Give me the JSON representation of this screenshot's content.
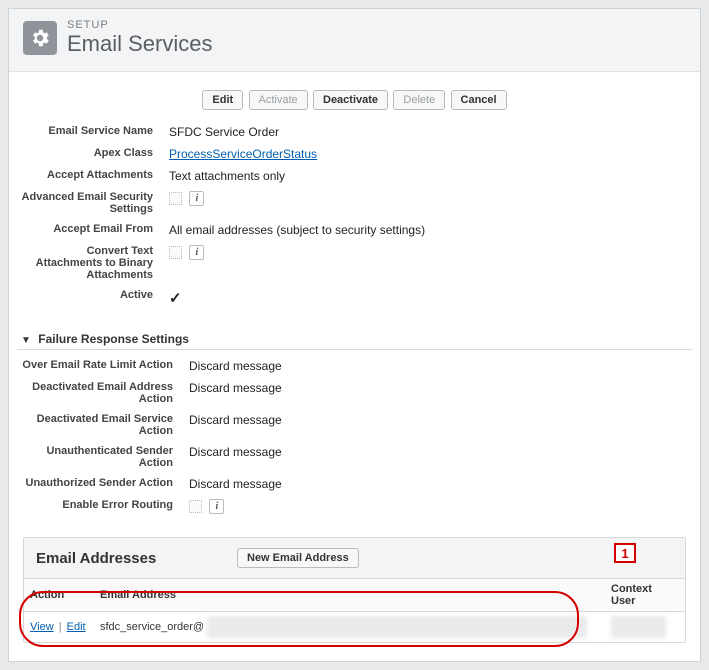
{
  "header": {
    "eyebrow": "SETUP",
    "title": "Email Services"
  },
  "toolbar": {
    "edit": "Edit",
    "activate": "Activate",
    "deactivate": "Deactivate",
    "delete": "Delete",
    "cancel": "Cancel"
  },
  "details": {
    "email_service_name": {
      "label": "Email Service Name",
      "value": "SFDC Service Order"
    },
    "apex_class": {
      "label": "Apex Class",
      "value": "ProcessServiceOrderStatus"
    },
    "accept_attachments": {
      "label": "Accept Attachments",
      "value": "Text attachments only"
    },
    "advanced_security": {
      "label": "Advanced Email Security Settings"
    },
    "accept_email_from": {
      "label": "Accept Email From",
      "value": "All email addresses (subject to security settings)"
    },
    "convert_text": {
      "label": "Convert Text Attachments to Binary Attachments"
    },
    "active": {
      "label": "Active"
    }
  },
  "failure": {
    "section_title": "Failure Response Settings",
    "over_rate": {
      "label": "Over Email Rate Limit Action",
      "value": "Discard message"
    },
    "deact_addr": {
      "label": "Deactivated Email Address Action",
      "value": "Discard message"
    },
    "deact_svc": {
      "label": "Deactivated Email Service Action",
      "value": "Discard message"
    },
    "unauth_sender": {
      "label": "Unauthenticated Sender Action",
      "value": "Discard message"
    },
    "unauthz_sender": {
      "label": "Unauthorized Sender Action",
      "value": "Discard message"
    },
    "error_routing": {
      "label": "Enable Error Routing"
    }
  },
  "addresses": {
    "title": "Email Addresses",
    "new_btn": "New Email Address",
    "cols": {
      "action": "Action",
      "email": "Email Address",
      "context": "Context User"
    },
    "row": {
      "view": "View",
      "edit": "Edit",
      "prefix": "sfdc_service_order@"
    }
  },
  "callout": {
    "num": "1"
  }
}
